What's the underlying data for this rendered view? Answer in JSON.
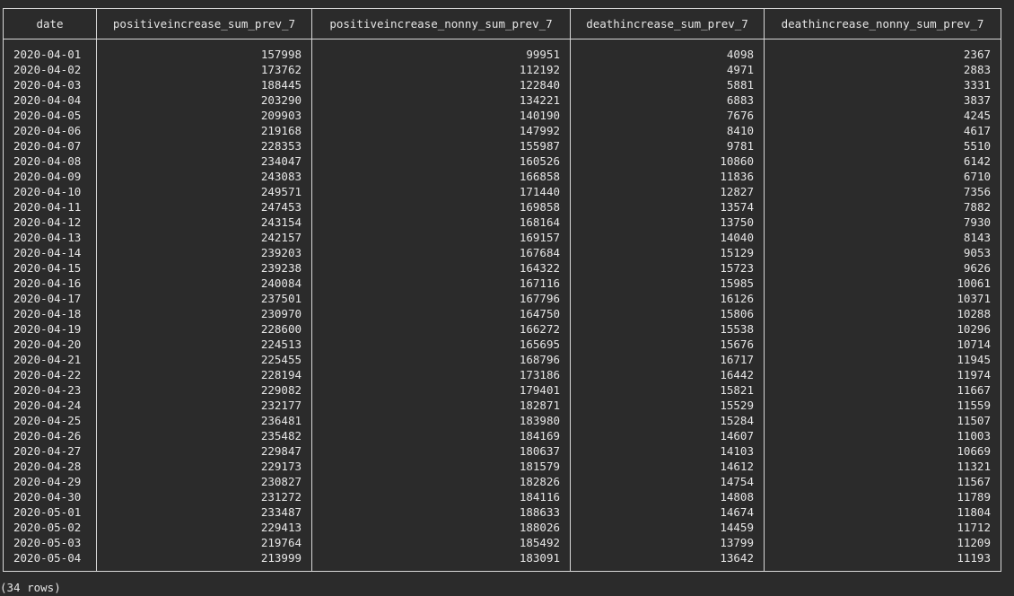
{
  "columns": [
    "date",
    "positiveincrease_sum_prev_7",
    "positiveincrease_nonny_sum_prev_7",
    "deathincrease_sum_prev_7",
    "deathincrease_nonny_sum_prev_7"
  ],
  "rows": [
    [
      "2020-04-01",
      "157998",
      "99951",
      "4098",
      "2367"
    ],
    [
      "2020-04-02",
      "173762",
      "112192",
      "4971",
      "2883"
    ],
    [
      "2020-04-03",
      "188445",
      "122840",
      "5881",
      "3331"
    ],
    [
      "2020-04-04",
      "203290",
      "134221",
      "6883",
      "3837"
    ],
    [
      "2020-04-05",
      "209903",
      "140190",
      "7676",
      "4245"
    ],
    [
      "2020-04-06",
      "219168",
      "147992",
      "8410",
      "4617"
    ],
    [
      "2020-04-07",
      "228353",
      "155987",
      "9781",
      "5510"
    ],
    [
      "2020-04-08",
      "234047",
      "160526",
      "10860",
      "6142"
    ],
    [
      "2020-04-09",
      "243083",
      "166858",
      "11836",
      "6710"
    ],
    [
      "2020-04-10",
      "249571",
      "171440",
      "12827",
      "7356"
    ],
    [
      "2020-04-11",
      "247453",
      "169858",
      "13574",
      "7882"
    ],
    [
      "2020-04-12",
      "243154",
      "168164",
      "13750",
      "7930"
    ],
    [
      "2020-04-13",
      "242157",
      "169157",
      "14040",
      "8143"
    ],
    [
      "2020-04-14",
      "239203",
      "167684",
      "15129",
      "9053"
    ],
    [
      "2020-04-15",
      "239238",
      "164322",
      "15723",
      "9626"
    ],
    [
      "2020-04-16",
      "240084",
      "167116",
      "15985",
      "10061"
    ],
    [
      "2020-04-17",
      "237501",
      "167796",
      "16126",
      "10371"
    ],
    [
      "2020-04-18",
      "230970",
      "164750",
      "15806",
      "10288"
    ],
    [
      "2020-04-19",
      "228600",
      "166272",
      "15538",
      "10296"
    ],
    [
      "2020-04-20",
      "224513",
      "165695",
      "15676",
      "10714"
    ],
    [
      "2020-04-21",
      "225455",
      "168796",
      "16717",
      "11945"
    ],
    [
      "2020-04-22",
      "228194",
      "173186",
      "16442",
      "11974"
    ],
    [
      "2020-04-23",
      "229082",
      "179401",
      "15821",
      "11667"
    ],
    [
      "2020-04-24",
      "232177",
      "182871",
      "15529",
      "11559"
    ],
    [
      "2020-04-25",
      "236481",
      "183980",
      "15284",
      "11507"
    ],
    [
      "2020-04-26",
      "235482",
      "184169",
      "14607",
      "11003"
    ],
    [
      "2020-04-27",
      "229847",
      "180637",
      "14103",
      "10669"
    ],
    [
      "2020-04-28",
      "229173",
      "181579",
      "14612",
      "11321"
    ],
    [
      "2020-04-29",
      "230827",
      "182826",
      "14754",
      "11567"
    ],
    [
      "2020-04-30",
      "231272",
      "184116",
      "14808",
      "11789"
    ],
    [
      "2020-05-01",
      "233487",
      "188633",
      "14674",
      "11804"
    ],
    [
      "2020-05-02",
      "229413",
      "188026",
      "14459",
      "11712"
    ],
    [
      "2020-05-03",
      "219764",
      "185492",
      "13799",
      "11209"
    ],
    [
      "2020-05-04",
      "213999",
      "183091",
      "13642",
      "11193"
    ]
  ],
  "footer": "(34 rows)"
}
